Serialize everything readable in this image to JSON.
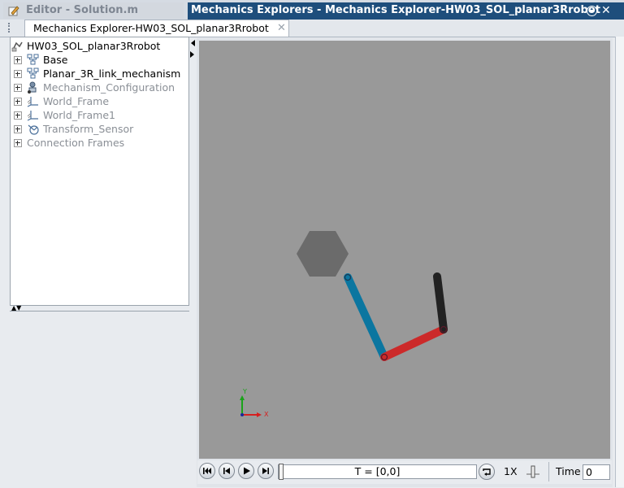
{
  "window_tabs": {
    "editor": "Editor - Solution.m",
    "mech": "Mechanics Explorers - Mechanics Explorer-HW03_SOL_planar3Rrobot"
  },
  "doc_tab": {
    "label": "Mechanics Explorer-HW03_SOL_planar3Rrobot"
  },
  "tree": {
    "root": "HW03_SOL_planar3Rrobot",
    "items": [
      {
        "label": "Base",
        "icon": "subsystem-icon",
        "muted": false
      },
      {
        "label": "Planar_3R_link_mechanism",
        "icon": "subsystem-icon",
        "muted": false
      },
      {
        "label": "Mechanism_Configuration",
        "icon": "mechanism-config-icon",
        "muted": true
      },
      {
        "label": "World_Frame",
        "icon": "world-frame-icon",
        "muted": true
      },
      {
        "label": "World_Frame1",
        "icon": "world-frame-icon",
        "muted": true
      },
      {
        "label": "Transform_Sensor",
        "icon": "transform-sensor-icon",
        "muted": true
      },
      {
        "label": "Connection Frames",
        "icon": "none",
        "muted": true
      }
    ]
  },
  "scene": {
    "axis_labels": {
      "x": "X",
      "y": "Y"
    },
    "colors": {
      "background": "#999999",
      "base": "#6b6b6b",
      "link1": "#0b76a0",
      "link2": "#cc2a2a",
      "link3": "#222222"
    }
  },
  "playback": {
    "time_display": "T = [0,0]",
    "speed_label": "1X",
    "time_label": "Time",
    "time_value": "0"
  }
}
